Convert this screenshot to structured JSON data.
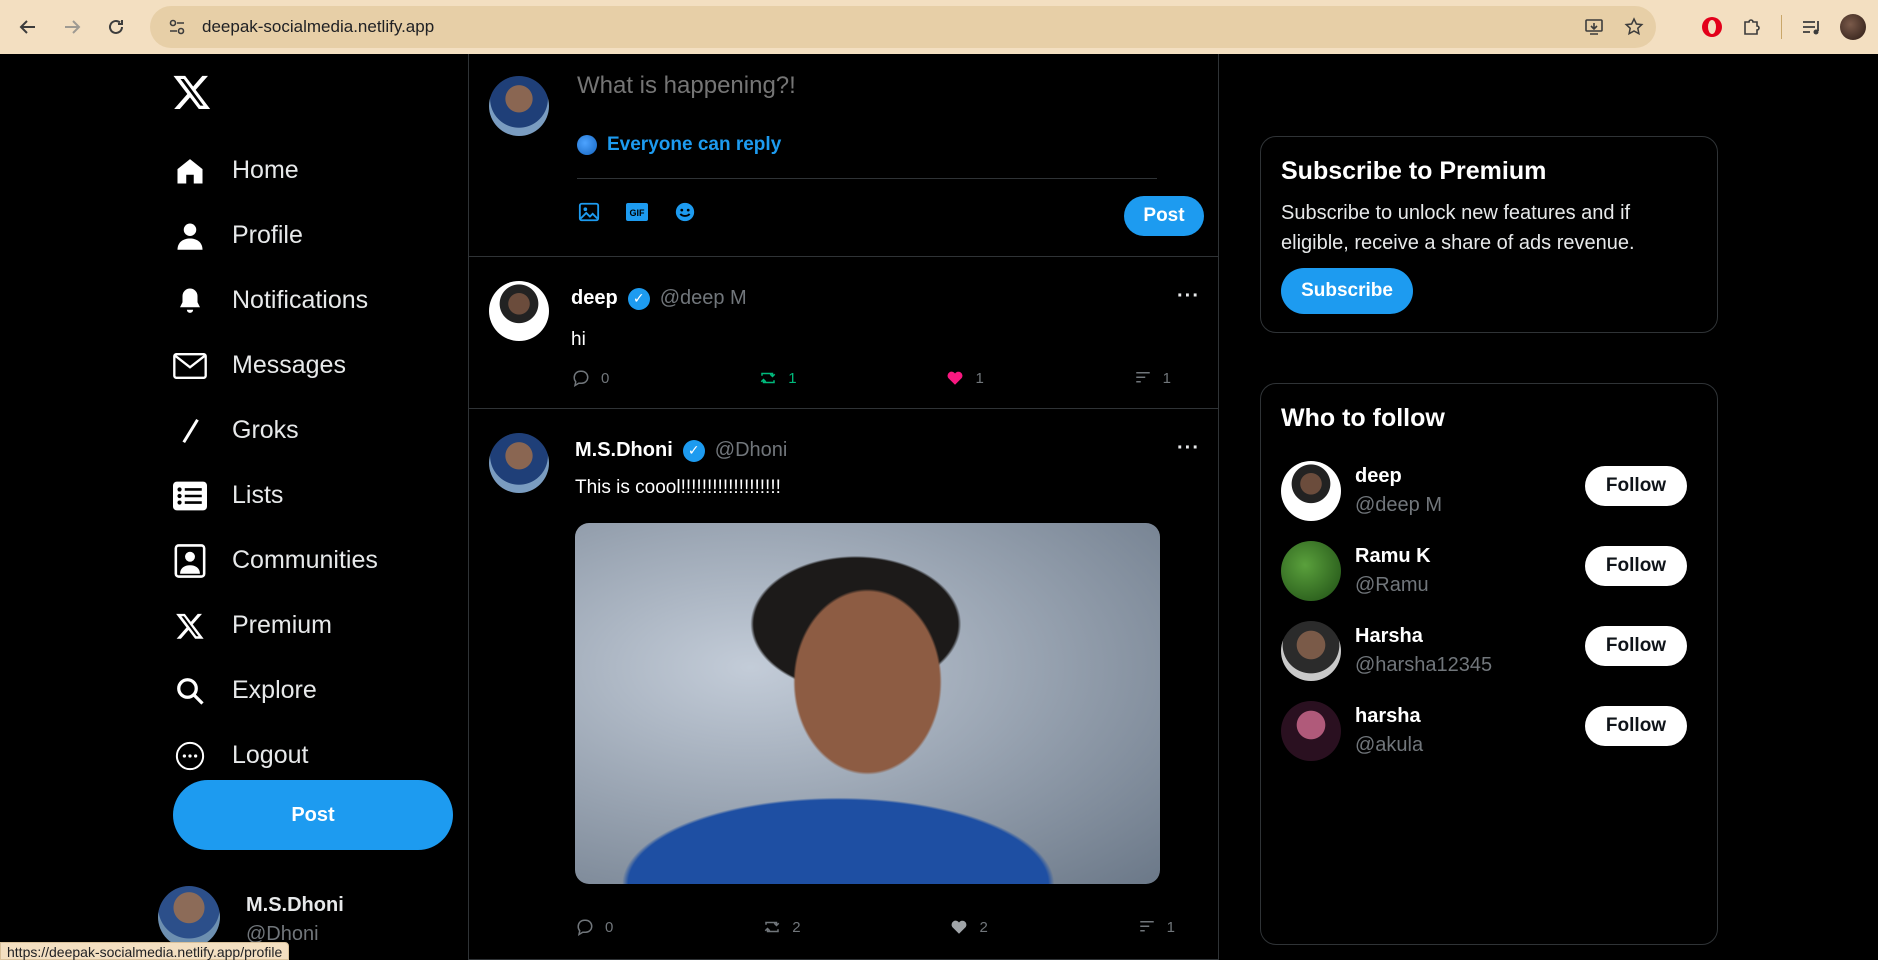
{
  "browser": {
    "url": "deepak-socialmedia.netlify.app",
    "status_url": "https://deepak-socialmedia.netlify.app/profile"
  },
  "nav": {
    "items": [
      {
        "label": "Home",
        "icon": "home-icon"
      },
      {
        "label": "Profile",
        "icon": "profile-icon"
      },
      {
        "label": "Notifications",
        "icon": "bell-icon"
      },
      {
        "label": "Messages",
        "icon": "mail-icon"
      },
      {
        "label": "Groks",
        "icon": "grok-icon"
      },
      {
        "label": "Lists",
        "icon": "list-icon"
      },
      {
        "label": "Communities",
        "icon": "communities-icon"
      },
      {
        "label": "Premium",
        "icon": "x-icon"
      },
      {
        "label": "Explore",
        "icon": "search-icon"
      },
      {
        "label": "Logout",
        "icon": "more-circle-icon"
      }
    ],
    "post_label": "Post",
    "account": {
      "name": "M.S.Dhoni",
      "handle": "@Dhoni"
    }
  },
  "composer": {
    "placeholder": "What is happening?!",
    "reply_setting": "Everyone can reply",
    "post_label": "Post"
  },
  "tweets": [
    {
      "name": "deep",
      "handle": "@deep M",
      "text": "hi",
      "replies": "0",
      "retweets": "1",
      "likes": "1",
      "views": "1"
    },
    {
      "name": "M.S.Dhoni",
      "handle": "@Dhoni",
      "text": "This is coool!!!!!!!!!!!!!!!!!!!",
      "replies": "0",
      "retweets": "2",
      "likes": "2",
      "views": "1"
    }
  ],
  "premium": {
    "title": "Subscribe to Premium",
    "text": "Subscribe to unlock new features and if eligible, receive a share of ads revenue.",
    "button": "Subscribe"
  },
  "who_to_follow": {
    "title": "Who to follow",
    "follow_label": "Follow",
    "users": [
      {
        "name": "deep",
        "handle": "@deep M"
      },
      {
        "name": "Ramu K",
        "handle": "@Ramu"
      },
      {
        "name": "Harsha",
        "handle": "@harsha12345"
      },
      {
        "name": "harsha",
        "handle": "@akula"
      }
    ]
  },
  "colors": {
    "accent": "#1d9bf0",
    "like": "#f91880",
    "retweet": "#00ba7c",
    "background": "#000000",
    "browser_chrome": "#f3dfc1"
  }
}
